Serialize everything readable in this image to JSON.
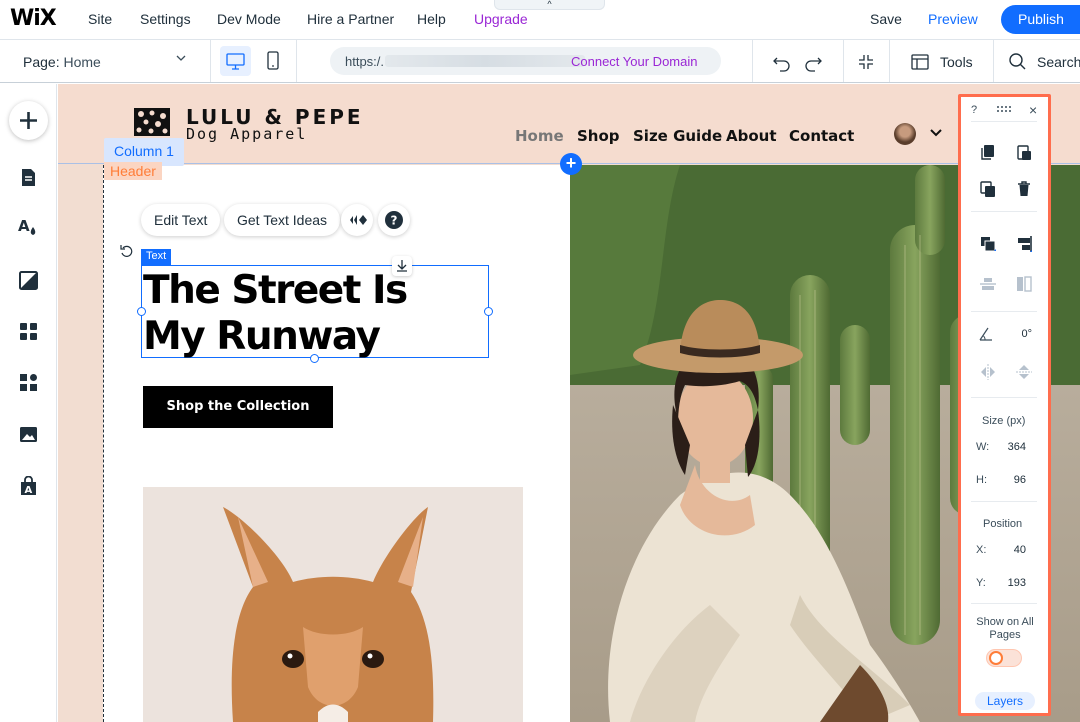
{
  "topbar": {
    "logo": "WiX",
    "menu": [
      "Site",
      "Settings",
      "Dev Mode",
      "Hire a Partner",
      "Help",
      "Upgrade"
    ],
    "collapse_glyph": "^",
    "save": "Save",
    "preview": "Preview",
    "publish": "Publish"
  },
  "secondbar": {
    "page_label": "Page:",
    "page_value": "Home",
    "url": "https:/.",
    "connect_domain": "Connect Your Domain",
    "tools": "Tools",
    "search": "Search"
  },
  "canvas": {
    "brand_name": "LULU & PEPE",
    "brand_sub": "Dog Apparel",
    "nav": [
      "Home",
      "Shop",
      "Size Guide",
      "About",
      "Contact"
    ],
    "column_label": "Column 1",
    "header_label": "Header",
    "edit_text": "Edit Text",
    "get_text_ideas": "Get Text Ideas",
    "help_glyph": "?",
    "text_tag": "Text",
    "headline_1": "The Street Is",
    "headline_2": "My Runway",
    "shop_button": "Shop the Collection",
    "plus_glyph": "+"
  },
  "panel": {
    "help": "?",
    "close": "×",
    "rotation": "0°",
    "size_title": "Size (px)",
    "w_label": "W:",
    "w_value": "364",
    "h_label": "H:",
    "h_value": "96",
    "position_title": "Position",
    "x_label": "X:",
    "x_value": "40",
    "y_label": "Y:",
    "y_value": "193",
    "show_all_pages": "Show on All Pages",
    "layers": "Layers"
  },
  "colors": {
    "accent": "#116dff",
    "upgrade": "#9a27d5",
    "panel_border": "#ff6d4d",
    "header_bg": "#f5dccf"
  }
}
